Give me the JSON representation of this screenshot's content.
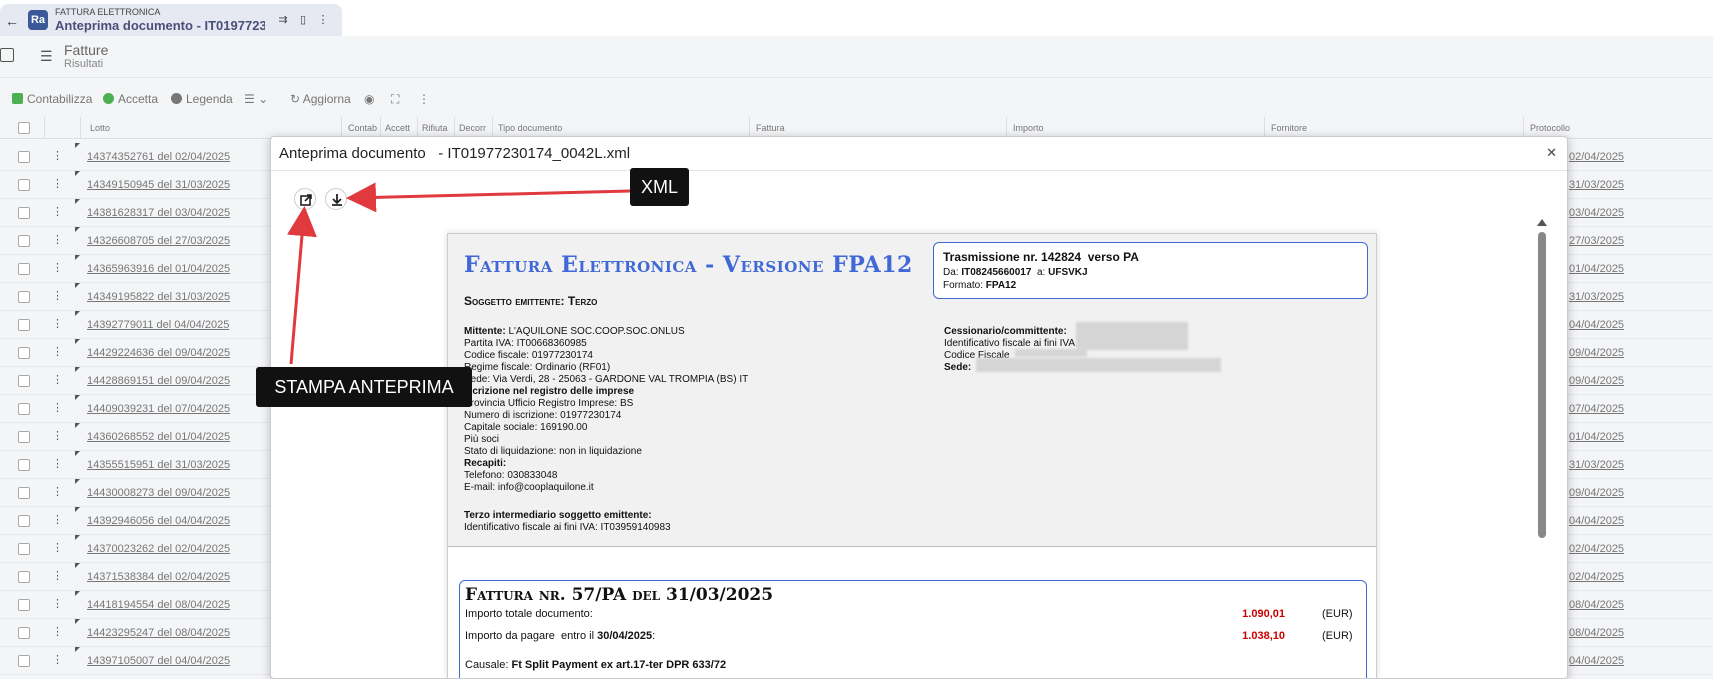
{
  "tab": {
    "app_name": "FATTURA ELETTRONICA",
    "title": "Anteprima documento - IT019772301…"
  },
  "header": {
    "title": "Fatture",
    "subtitle": "Risultati"
  },
  "toolbar": {
    "contabilizza": "Contabilizza",
    "accetta": "Accetta",
    "legenda": "Legenda",
    "aggiorna": "Aggiorna"
  },
  "table": {
    "columns": [
      "Lotto",
      "Contab",
      "Accett",
      "Rifiuta",
      "Decorr",
      "Tipo documento",
      "Fattura",
      "Importo",
      "Fornitore",
      "Protocollo"
    ],
    "rows": [
      {
        "lotto": "14374352761 del 02/04/2025",
        "protocollo": "02/04/2025"
      },
      {
        "lotto": "14349150945 del 31/03/2025",
        "protocollo": "31/03/2025"
      },
      {
        "lotto": "14381628317 del 03/04/2025",
        "protocollo": "03/04/2025"
      },
      {
        "lotto": "14326608705 del 27/03/2025",
        "protocollo": "27/03/2025"
      },
      {
        "lotto": "14365963916 del 01/04/2025",
        "protocollo": "01/04/2025"
      },
      {
        "lotto": "14349195822 del 31/03/2025",
        "protocollo": "31/03/2025"
      },
      {
        "lotto": "14392779011 del 04/04/2025",
        "protocollo": "04/04/2025"
      },
      {
        "lotto": "14429224636 del 09/04/2025",
        "protocollo": "09/04/2025"
      },
      {
        "lotto": "14428869151 del 09/04/2025",
        "protocollo": "09/04/2025"
      },
      {
        "lotto": "14409039231 del 07/04/2025",
        "protocollo": "07/04/2025"
      },
      {
        "lotto": "14360268552 del 01/04/2025",
        "protocollo": "01/04/2025"
      },
      {
        "lotto": "14355515951 del 31/03/2025",
        "protocollo": "31/03/2025"
      },
      {
        "lotto": "14430008273 del 09/04/2025",
        "protocollo": "09/04/2025"
      },
      {
        "lotto": "14392946056 del 04/04/2025",
        "protocollo": "04/04/2025"
      },
      {
        "lotto": "14370023262 del 02/04/2025",
        "protocollo": "02/04/2025"
      },
      {
        "lotto": "14371538384 del 02/04/2025",
        "protocollo": "02/04/2025"
      },
      {
        "lotto": "14418194554 del 08/04/2025",
        "protocollo": "08/04/2025"
      },
      {
        "lotto": "14423295247 del 08/04/2025",
        "protocollo": "08/04/2025"
      },
      {
        "lotto": "14397105007 del 04/04/2025",
        "protocollo": "04/04/2025"
      }
    ]
  },
  "modal": {
    "title": "Anteprima documento   - IT01977230174_0042L.xml"
  },
  "document": {
    "heading": "Fattura Elettronica - Versione FPA12",
    "trasmissione": {
      "line1": "Trasmissione nr. 142824  verso PA",
      "da_label": "Da:",
      "da_value": "IT08245660017",
      "a_label": "a:",
      "a_value": "UFSVKJ",
      "formato_label": "Formato:",
      "formato_value": "FPA12"
    },
    "soggetto": "Soggetto emittente: Terzo",
    "mittente": [
      {
        "label": "Mittente:",
        "value": "L'AQUILONE SOC.COOP.SOC.ONLUS",
        "bold_label": true
      },
      {
        "label": "Partita IVA:",
        "value": "IT00668360985"
      },
      {
        "label": "Codice fiscale:",
        "value": "01977230174"
      },
      {
        "label": "Regime fiscale:",
        "value": "Ordinario (RF01)"
      },
      {
        "label": "Sede:",
        "value": "Via Verdi, 28 - 25063 - GARDONE VAL TROMPIA (BS) IT"
      },
      {
        "label": "Iscrizione nel registro delle imprese",
        "value": "",
        "bold_label": true
      },
      {
        "label": "Provincia Ufficio Registro Imprese:",
        "value": "BS"
      },
      {
        "label": "Numero di iscrizione:",
        "value": "01977230174"
      },
      {
        "label": "Capitale sociale:",
        "value": "169190.00"
      },
      {
        "label": "Più soci",
        "value": ""
      },
      {
        "label": "Stato di liquidazione:",
        "value": "non in liquidazione"
      },
      {
        "label": "Recapiti:",
        "value": "",
        "bold_label": true
      },
      {
        "label": "Telefono:",
        "value": "030833048"
      },
      {
        "label": "E-mail:",
        "value": "info@cooplaquilone.it"
      }
    ],
    "terzo": {
      "title": "Terzo intermediario soggetto emittente:",
      "line": "Identificativo fiscale ai fini IVA: IT03959140983"
    },
    "cessionario": {
      "title": "Cessionario/committente:",
      "id_label": "Identificativo fiscale ai fini IVA",
      "cf_label": "Codice Fiscale",
      "sede_label": "Sede:"
    },
    "fattura": {
      "title": "Fattura nr. 57/PA del 31/03/2025",
      "importo_label": "Importo totale documento:",
      "importo_value": "1.090,01",
      "pagare_label": "Importo da pagare  entro il ",
      "pagare_date": "30/04/2025",
      "pagare_value": "1.038,10",
      "currency": "(EUR)",
      "causale_label": "Causale:",
      "causale_value": "Ft Split Payment ex art.17-ter DPR 633/72"
    }
  },
  "annotations": {
    "xml": "XML",
    "stampa": "STAMPA ANTEPRIMA"
  },
  "colors": {
    "accent": "#4068d6",
    "arrow": "#e0393e",
    "amount": "#cc0000"
  }
}
